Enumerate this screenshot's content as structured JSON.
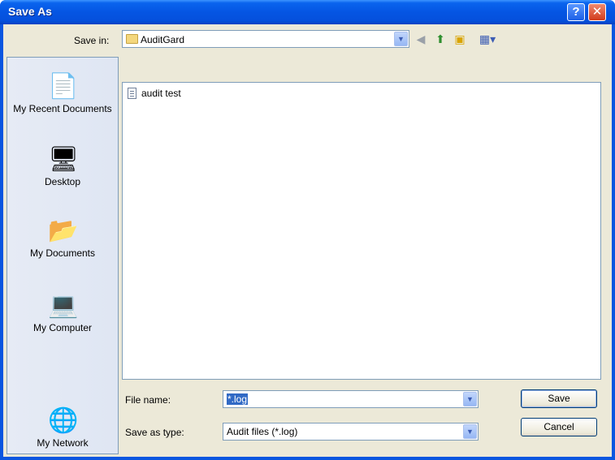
{
  "window": {
    "title": "Save As"
  },
  "titlebar_buttons": {
    "help": "?",
    "close": "✕"
  },
  "save_in": {
    "label": "Save in:",
    "value": "AuditGard"
  },
  "places": [
    {
      "label": "My Recent Documents",
      "icon": "recent-documents-icon"
    },
    {
      "label": "Desktop",
      "icon": "desktop-icon"
    },
    {
      "label": "My Documents",
      "icon": "my-documents-icon"
    },
    {
      "label": "My Computer",
      "icon": "my-computer-icon"
    },
    {
      "label": "My Network",
      "icon": "my-network-icon"
    }
  ],
  "files": [
    {
      "name": "audit test",
      "icon": "text-document-icon"
    }
  ],
  "file_name": {
    "label": "File name:",
    "value": "*.log"
  },
  "save_as_type": {
    "label": "Save as type:",
    "value": "Audit files (*.log)"
  },
  "buttons": {
    "save": "Save",
    "cancel": "Cancel"
  },
  "colors": {
    "titlebar": "#0555e3",
    "dialog_bg": "#ece9d8",
    "selection": "#316ac5"
  }
}
